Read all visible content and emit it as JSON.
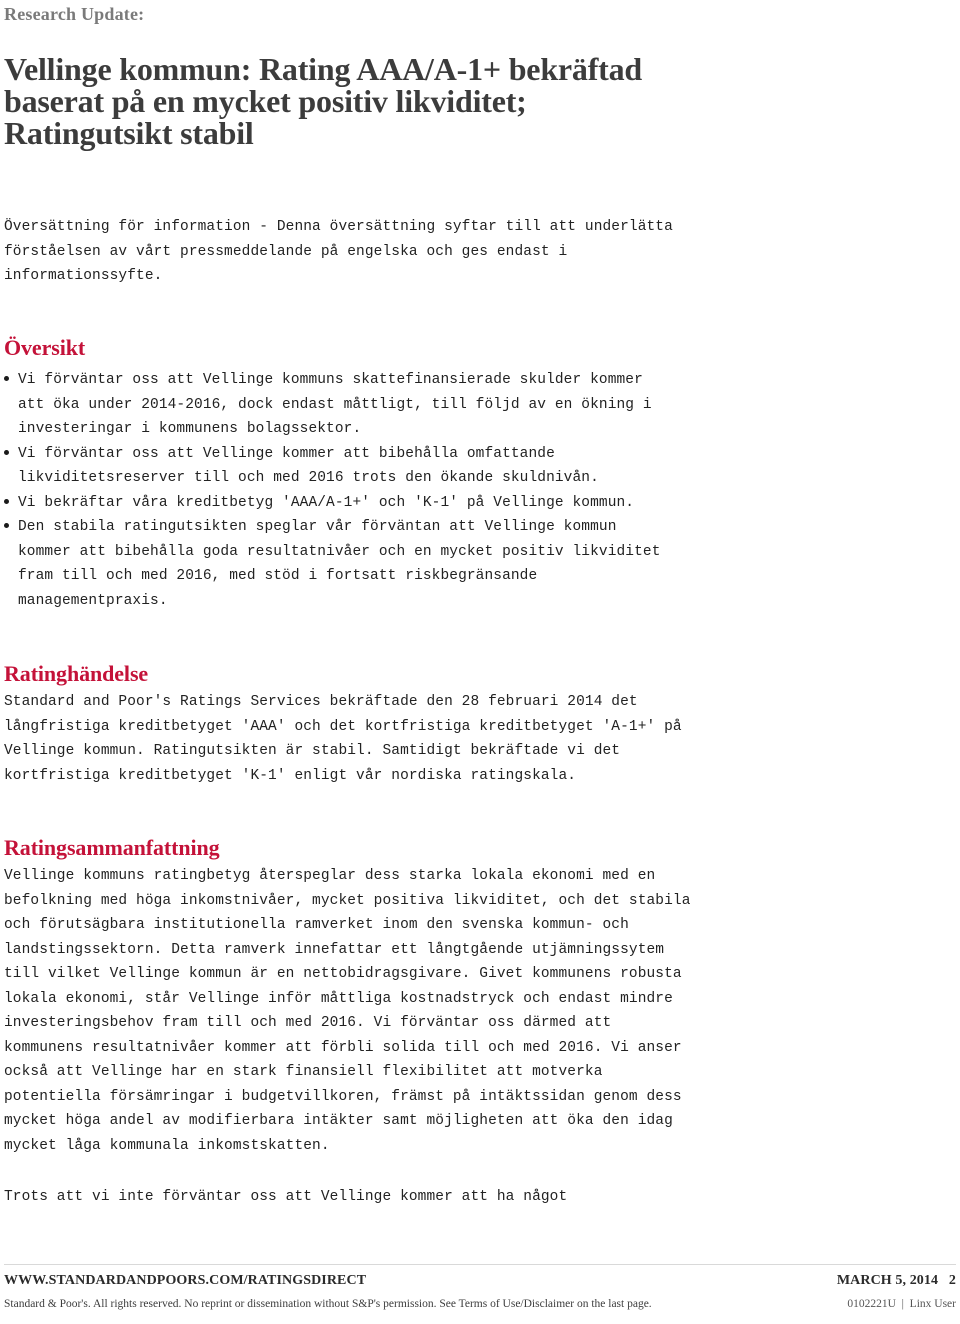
{
  "header": {
    "kicker": "Research Update:",
    "title_lines": [
      "Vellinge kommun: Rating AAA/A-1+ bekräftad",
      "baserat på en mycket positiv likviditet;",
      "Ratingutsikt stabil"
    ]
  },
  "translation_note": {
    "lines": [
      "Översättning för information - Denna översättning syftar till att underlätta",
      "förståelsen av vårt pressmeddelande på engelska och ges endast i",
      "informationssyfte."
    ]
  },
  "sections": {
    "overview": {
      "heading": "Översikt",
      "bullets": [
        {
          "lines": [
            "Vi förväntar oss att Vellinge kommuns skattefinansierade skulder kommer",
            "att öka under 2014-2016, dock endast måttligt, till följd av en ökning i",
            "investeringar i kommunens bolagssektor."
          ]
        },
        {
          "lines": [
            "Vi förväntar oss att Vellinge kommer att bibehålla omfattande",
            "likviditetsreserver till och med 2016 trots den ökande skuldnivån."
          ]
        },
        {
          "lines": [
            "Vi bekräftar våra kreditbetyg 'AAA/A-1+' och 'K-1' på Vellinge kommun."
          ]
        },
        {
          "lines": [
            "Den stabila ratingutsikten speglar vår förväntan att Vellinge kommun",
            "kommer att bibehålla goda resultatnivåer och en mycket positiv likviditet",
            "fram till och med 2016, med stöd i fortsatt riskbegränsande",
            "managementpraxis."
          ]
        }
      ]
    },
    "rating_event": {
      "heading": "Ratinghändelse",
      "lines": [
        "Standard and Poor's Ratings Services bekräftade den 28 februari 2014 det",
        "långfristiga kreditbetyget 'AAA' och det kortfristiga kreditbetyget 'A-1+' på",
        "Vellinge kommun. Ratingutsikten är stabil. Samtidigt bekräftade vi det",
        "kortfristiga kreditbetyget 'K-1' enligt vår nordiska ratingskala."
      ]
    },
    "rating_summary": {
      "heading": "Ratingsammanfattning",
      "lines": [
        "Vellinge kommuns ratingbetyg återspeglar dess starka lokala ekonomi med en",
        "befolkning med höga inkomstnivåer, mycket positiva likviditet, och det stabila",
        "och förutsägbara institutionella ramverket inom den svenska kommun- och",
        "landstingssektorn. Detta ramverk innefattar ett långtgående utjämningssytem",
        "till vilket Vellinge kommun är en nettobidragsgivare. Givet kommunens robusta",
        "lokala ekonomi, står Vellinge inför måttliga kostnadstryck och endast mindre",
        "investeringsbehov fram till och med 2016. Vi förväntar oss därmed att",
        "kommunens resultatnivåer kommer att förbli solida till och med 2016. Vi anser",
        "också att Vellinge har en stark finansiell flexibilitet att motverka",
        "potentiella försämringar i budgetvillkoren, främst på intäktssidan genom dess",
        "mycket höga andel av modifierbara intäkter samt möjligheten att öka den idag",
        "mycket låga kommunala inkomstskatten."
      ]
    },
    "continuation": {
      "lines": [
        "Trots att vi inte förväntar oss att Vellinge kommer att ha något"
      ]
    }
  },
  "footer": {
    "site": "WWW.STANDARDANDPOORS.COM/RATINGSDIRECT",
    "date_page": "MARCH 5, 2014   2",
    "copyright": "Standard & Poor's. All rights reserved. No reprint or dissemination without S&P's permission. See Terms of Use/Disclaimer on the last page.",
    "doc_id": "0102221U  |  Linx User"
  },
  "colors": {
    "heading_red": "#c41239",
    "kicker_gray": "#7a7a7a",
    "title_gray": "#3c3c3c",
    "body_text": "#222222"
  }
}
